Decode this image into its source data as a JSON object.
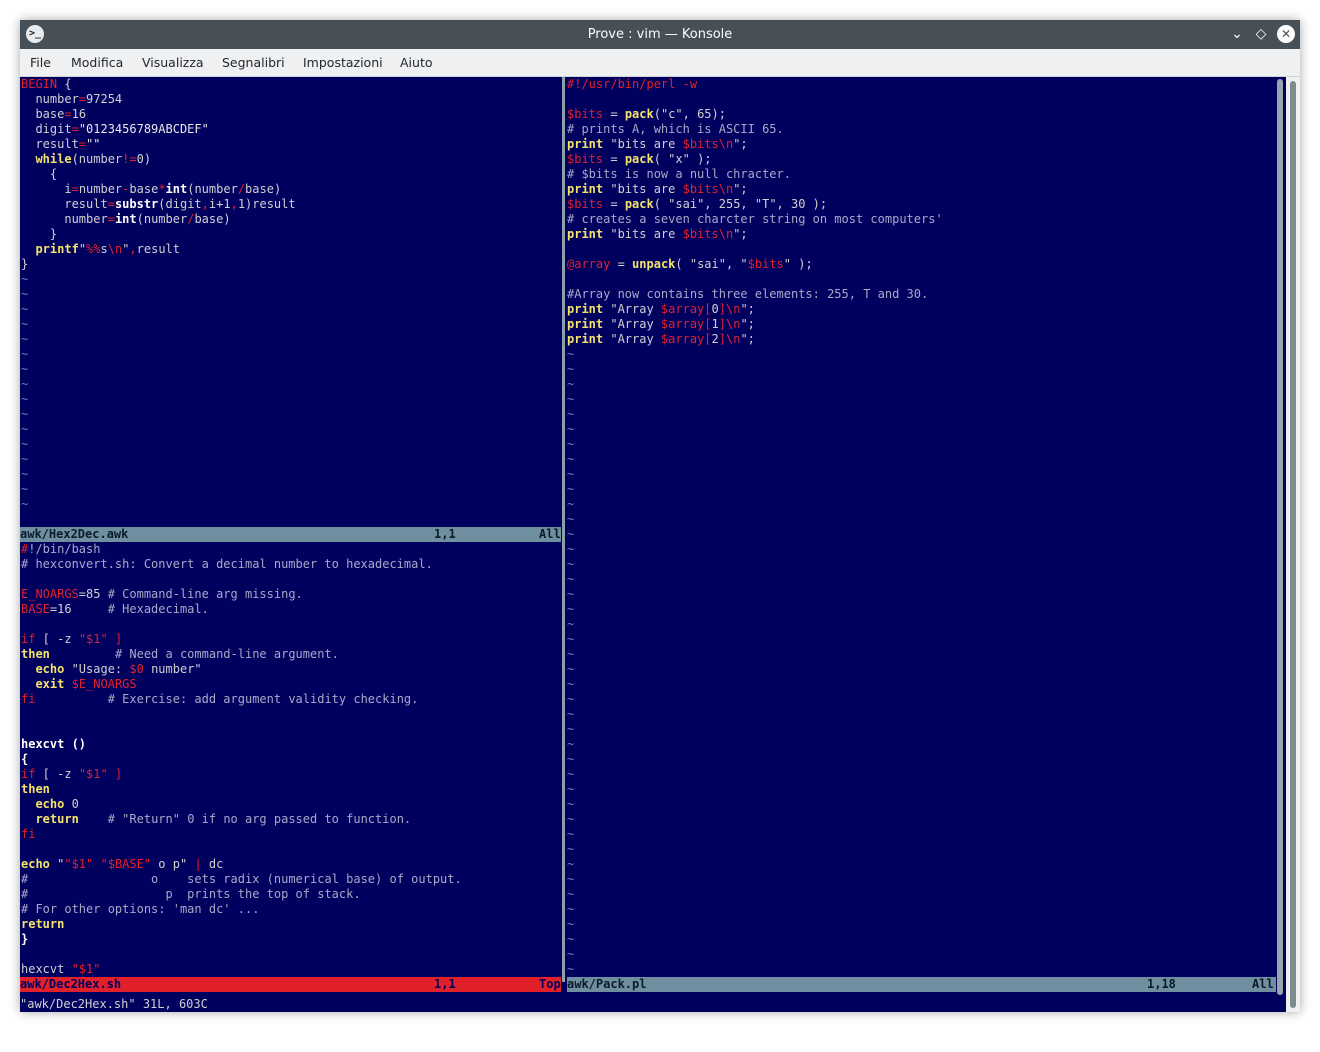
{
  "window": {
    "title": "Prove : vim — Konsole"
  },
  "menu": [
    "File",
    "Modifica",
    "Visualizza",
    "Segnalibri",
    "Impostazioni",
    "Aiuto"
  ],
  "panes": {
    "awk": {
      "lines": [
        [
          [
            "BEGIN",
            "red"
          ],
          [
            " {",
            ""
          ]
        ],
        [
          [
            "  number",
            ""
          ],
          [
            "=",
            "red"
          ],
          [
            "97254",
            ""
          ]
        ],
        [
          [
            "  base",
            ""
          ],
          [
            "=",
            "red"
          ],
          [
            "16",
            ""
          ]
        ],
        [
          [
            "  digit",
            ""
          ],
          [
            "=",
            "red"
          ],
          [
            "\"0123456789ABCDEF\"",
            "str"
          ]
        ],
        [
          [
            "  result",
            ""
          ],
          [
            "=",
            "red"
          ],
          [
            "\"\"",
            "str"
          ]
        ],
        [
          [
            "  ",
            ""
          ],
          [
            "while",
            "yel"
          ],
          [
            "(number",
            ""
          ],
          [
            "!=",
            "red"
          ],
          [
            "0)",
            ""
          ]
        ],
        [
          [
            "    {",
            ""
          ]
        ],
        [
          [
            "      i",
            ""
          ],
          [
            "=",
            "red"
          ],
          [
            "number",
            ""
          ],
          [
            "-",
            "red"
          ],
          [
            "base",
            ""
          ],
          [
            "*",
            "red"
          ],
          [
            "int",
            "wht"
          ],
          [
            "(number",
            ""
          ],
          [
            "/",
            "red"
          ],
          [
            "base)",
            ""
          ]
        ],
        [
          [
            "      result",
            ""
          ],
          [
            "=",
            "red"
          ],
          [
            "substr",
            "wht"
          ],
          [
            "(digit",
            ""
          ],
          [
            ",",
            "red"
          ],
          [
            "i+1",
            ""
          ],
          [
            ",",
            "red"
          ],
          [
            "1)result",
            ""
          ]
        ],
        [
          [
            "      number",
            ""
          ],
          [
            "=",
            "red"
          ],
          [
            "int",
            "wht"
          ],
          [
            "(number",
            ""
          ],
          [
            "/",
            "red"
          ],
          [
            "base)",
            ""
          ]
        ],
        [
          [
            "    }",
            ""
          ]
        ],
        [
          [
            "  ",
            ""
          ],
          [
            "printf",
            "yel"
          ],
          [
            "\"",
            ""
          ],
          [
            "%%",
            "red"
          ],
          [
            "s",
            ""
          ],
          [
            "\\n",
            "red"
          ],
          [
            "\"",
            ""
          ],
          [
            ",",
            "red"
          ],
          [
            "result",
            ""
          ]
        ],
        [
          [
            "}",
            ""
          ]
        ]
      ],
      "tildes": 16,
      "status": {
        "file": "awk/Hex2Dec.awk",
        "pos": "1,1",
        "pct": "All"
      }
    },
    "bash": {
      "lines": [
        [
          [
            "#",
            "red"
          ],
          [
            "!/bin/bash",
            "cmt"
          ]
        ],
        [
          [
            "# hexconvert.sh: Convert a decimal number to hexadecimal.",
            "cmt"
          ]
        ],
        [
          [
            "",
            ""
          ]
        ],
        [
          [
            "E_NOARGS",
            "red"
          ],
          [
            "=85 ",
            ""
          ],
          [
            "# Command-line arg missing.",
            "cmt"
          ]
        ],
        [
          [
            "BASE",
            "red"
          ],
          [
            "=16     ",
            ""
          ],
          [
            "# Hexadecimal.",
            "cmt"
          ]
        ],
        [
          [
            "",
            ""
          ]
        ],
        [
          [
            "if",
            "red"
          ],
          [
            " [ -z ",
            ""
          ],
          [
            "\"$1\"",
            "red"
          ],
          [
            " ]",
            "red"
          ]
        ],
        [
          [
            "then",
            "yel"
          ],
          [
            "         ",
            ""
          ],
          [
            "# Need a command-line argument.",
            "cmt"
          ]
        ],
        [
          [
            "  ",
            ""
          ],
          [
            "echo",
            "yel"
          ],
          [
            " \"Usage: ",
            ""
          ],
          [
            "$0",
            "red"
          ],
          [
            " number\"",
            ""
          ]
        ],
        [
          [
            "  ",
            ""
          ],
          [
            "exit",
            "yel"
          ],
          [
            " ",
            ""
          ],
          [
            "$E_NOARGS",
            "red"
          ]
        ],
        [
          [
            "fi",
            "red"
          ],
          [
            "          ",
            ""
          ],
          [
            "# Exercise: add argument validity checking.",
            "cmt"
          ]
        ],
        [
          [
            "",
            ""
          ]
        ],
        [
          [
            "",
            ""
          ]
        ],
        [
          [
            "hexcvt ()",
            "wht"
          ]
        ],
        [
          [
            "{",
            "wht"
          ]
        ],
        [
          [
            "if",
            "red"
          ],
          [
            " [ -z ",
            ""
          ],
          [
            "\"$1\"",
            "red"
          ],
          [
            " ]",
            "red"
          ]
        ],
        [
          [
            "then",
            "yel"
          ]
        ],
        [
          [
            "  ",
            ""
          ],
          [
            "echo",
            "yel"
          ],
          [
            " 0",
            ""
          ]
        ],
        [
          [
            "  ",
            ""
          ],
          [
            "return",
            "yel"
          ],
          [
            "    ",
            ""
          ],
          [
            "# \"Return\" 0 if no arg passed to function.",
            "cmt"
          ]
        ],
        [
          [
            "fi",
            "red"
          ]
        ],
        [
          [
            "",
            ""
          ]
        ],
        [
          [
            "echo",
            "yel"
          ],
          [
            " \"",
            ""
          ],
          [
            "\"$1\"",
            "red"
          ],
          [
            " ",
            ""
          ],
          [
            "\"$BASE\"",
            "red"
          ],
          [
            " o p\" ",
            ""
          ],
          [
            "|",
            "red"
          ],
          [
            " dc",
            ""
          ]
        ],
        [
          [
            "#",
            "cmt"
          ],
          [
            "                 o    sets radix (numerical base) of output.",
            "cmt"
          ]
        ],
        [
          [
            "#",
            "cmt"
          ],
          [
            "                   p  prints the top of stack.",
            "cmt"
          ]
        ],
        [
          [
            "# For other options: 'man dc' ...",
            "cmt"
          ]
        ],
        [
          [
            "return",
            "yel"
          ]
        ],
        [
          [
            "}",
            "wht"
          ]
        ],
        [
          [
            "",
            ""
          ]
        ],
        [
          [
            "hexcvt ",
            ""
          ],
          [
            "\"$1\"",
            "red"
          ]
        ]
      ],
      "status": {
        "file": "awk/Dec2Hex.sh",
        "pos": "1,1",
        "pct": "Top"
      }
    },
    "perl": {
      "lines": [
        [
          [
            "#!/usr/bin/perl -w",
            "red"
          ]
        ],
        [
          [
            "",
            ""
          ]
        ],
        [
          [
            "$bits",
            "red"
          ],
          [
            " = ",
            ""
          ],
          [
            "pack",
            "yel"
          ],
          [
            "(\"c\", 65);",
            ""
          ]
        ],
        [
          [
            "# prints A, which is ASCII 65.",
            "cmt"
          ]
        ],
        [
          [
            "print",
            "yel"
          ],
          [
            " \"bits are ",
            ""
          ],
          [
            "$bits",
            "red"
          ],
          [
            "\\n",
            "red"
          ],
          [
            "\";",
            ""
          ]
        ],
        [
          [
            "$bits",
            "red"
          ],
          [
            " = ",
            ""
          ],
          [
            "pack",
            "yel"
          ],
          [
            "( \"x\" );",
            ""
          ]
        ],
        [
          [
            "# $bits is now a null chracter.",
            "cmt"
          ]
        ],
        [
          [
            "print",
            "yel"
          ],
          [
            " \"bits are ",
            ""
          ],
          [
            "$bits",
            "red"
          ],
          [
            "\\n",
            "red"
          ],
          [
            "\";",
            ""
          ]
        ],
        [
          [
            "$bits",
            "red"
          ],
          [
            " = ",
            ""
          ],
          [
            "pack",
            "yel"
          ],
          [
            "( \"sai\", 255, \"T\", 30 );",
            ""
          ]
        ],
        [
          [
            "# creates a seven charcter string on most computers'",
            "cmt"
          ]
        ],
        [
          [
            "print",
            "yel"
          ],
          [
            " \"bits are ",
            ""
          ],
          [
            "$bits",
            "red"
          ],
          [
            "\\n",
            "red"
          ],
          [
            "\";",
            ""
          ]
        ],
        [
          [
            "",
            ""
          ]
        ],
        [
          [
            "@array",
            "red"
          ],
          [
            " = ",
            ""
          ],
          [
            "unpack",
            "yel"
          ],
          [
            "( \"sai\", \"",
            ""
          ],
          [
            "$bits",
            "red"
          ],
          [
            "\" );",
            ""
          ]
        ],
        [
          [
            "",
            ""
          ]
        ],
        [
          [
            "#Array now contains three elements: 255, T and 30.",
            "cmt"
          ]
        ],
        [
          [
            "print",
            "yel"
          ],
          [
            " \"Array ",
            ""
          ],
          [
            "$array",
            "red"
          ],
          [
            "[",
            "red"
          ],
          [
            "0",
            ""
          ],
          [
            "]",
            "red"
          ],
          [
            "\\n",
            "red"
          ],
          [
            "\";",
            ""
          ]
        ],
        [
          [
            "print",
            "yel"
          ],
          [
            " \"Array ",
            ""
          ],
          [
            "$array",
            "red"
          ],
          [
            "[",
            "red"
          ],
          [
            "1",
            ""
          ],
          [
            "]",
            "red"
          ],
          [
            "\\n",
            "red"
          ],
          [
            "\";",
            ""
          ]
        ],
        [
          [
            "print",
            "yel"
          ],
          [
            " \"Array ",
            ""
          ],
          [
            "$array",
            "red"
          ],
          [
            "[",
            "red"
          ],
          [
            "2",
            ""
          ],
          [
            "]",
            "red"
          ],
          [
            "\\n",
            "red"
          ],
          [
            "\";",
            ""
          ]
        ]
      ],
      "tildes": 42,
      "status": {
        "file": "awk/Pack.pl",
        "pos": "1,18",
        "pct": "All"
      }
    }
  },
  "cmdline": "\"awk/Dec2Hex.sh\" 31L, 603C",
  "colors": {
    "bg": "#00005f",
    "red": "#e2202a",
    "yellow": "#f5e26a",
    "statusbar_inactive": "#6f8fa0",
    "statusbar_active": "#e0202a"
  },
  "icons": {
    "app": "konsole-icon",
    "minimize": "chevron-down-icon",
    "maximize": "diamond-icon",
    "close": "close-icon"
  }
}
